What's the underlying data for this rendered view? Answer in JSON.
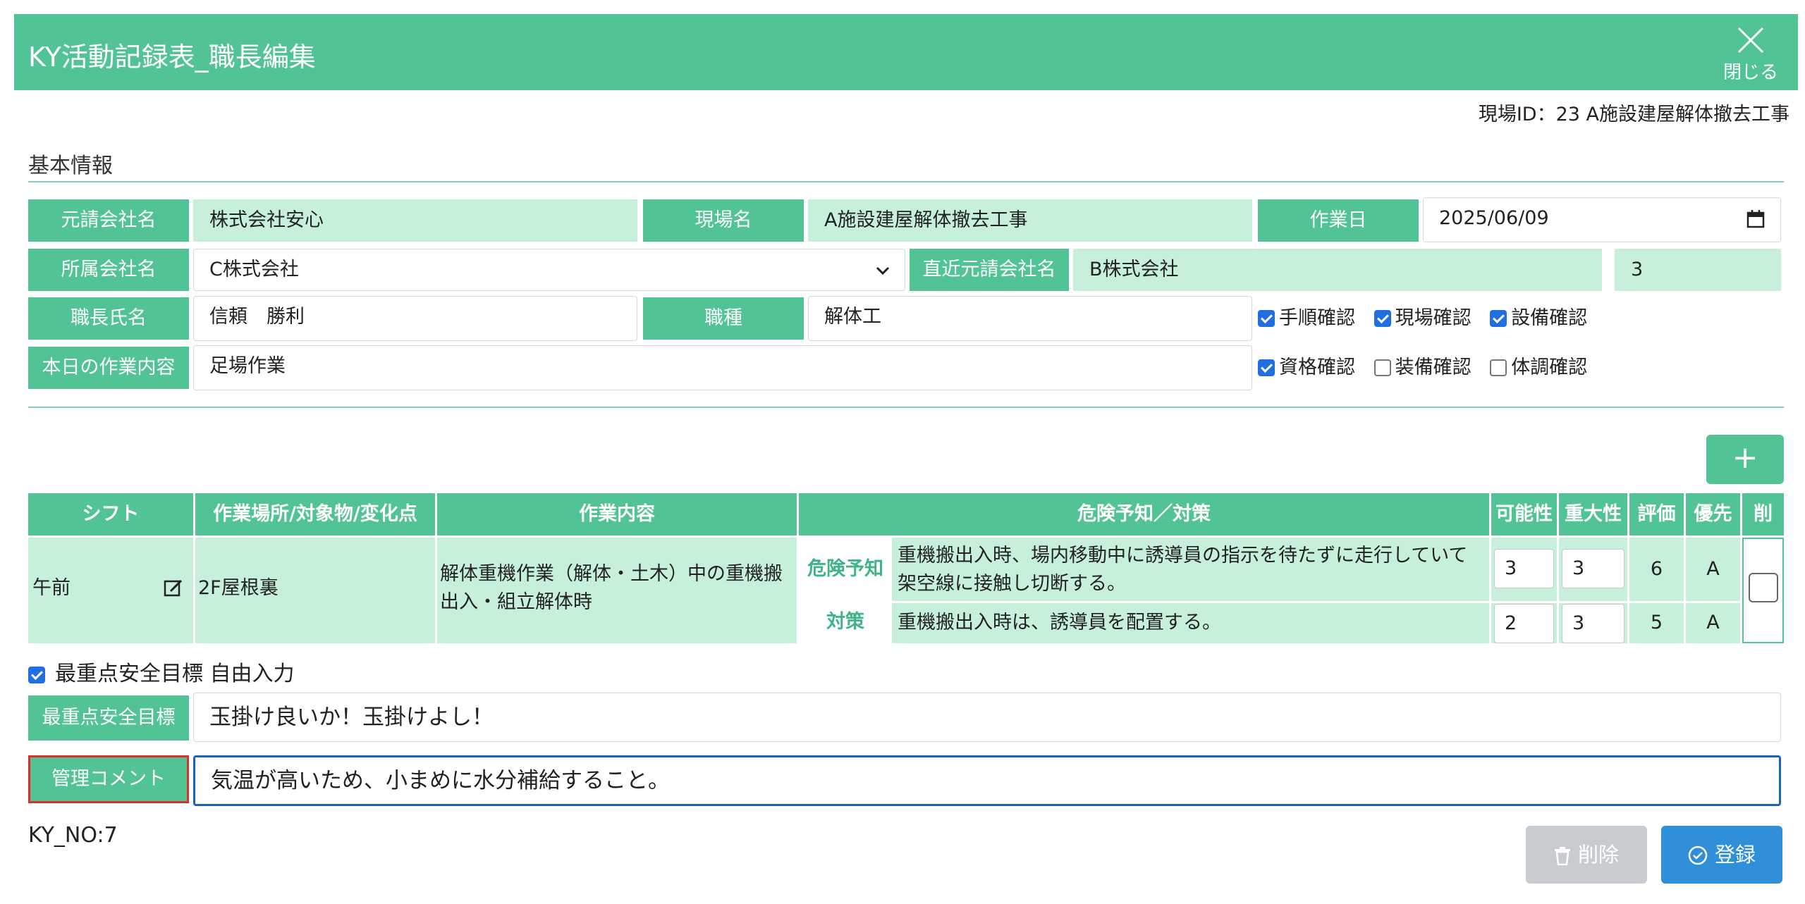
{
  "header": {
    "title": "KY活動記録表_職長編集",
    "close_label": "閉じる"
  },
  "site_id_label": "現場ID：23 A施設建屋解体撤去工事",
  "basic_info": {
    "section_title": "基本情報",
    "prime_company_label": "元請会社名",
    "prime_company_value": "株式会社安心",
    "site_name_label": "現場名",
    "site_name_value": "A施設建屋解体撤去工事",
    "work_date_label": "作業日",
    "work_date_value": "2025/06/09",
    "affiliated_company_label": "所属会社名",
    "affiliated_company_value": "C株式会社",
    "direct_prime_label": "直近元請会社名",
    "direct_prime_value": "B株式会社",
    "direct_prime_extra": "3",
    "foreman_label": "職長氏名",
    "foreman_value": "信頼　勝利",
    "job_type_label": "職種",
    "job_type_value": "解体工",
    "todays_work_label": "本日の作業内容",
    "todays_work_value": "足場作業",
    "checks": [
      {
        "label": "手順確認",
        "checked": true
      },
      {
        "label": "現場確認",
        "checked": true
      },
      {
        "label": "設備確認",
        "checked": true
      },
      {
        "label": "資格確認",
        "checked": true
      },
      {
        "label": "装備確認",
        "checked": false
      },
      {
        "label": "体調確認",
        "checked": false
      }
    ]
  },
  "add_button_label": "+",
  "table": {
    "headers": {
      "shift": "シフト",
      "place": "作業場所/対象物/変化点",
      "work": "作業内容",
      "hazard": "危険予知／対策",
      "possibility": "可能性",
      "severity": "重大性",
      "evaluation": "評価",
      "priority": "優先",
      "delete": "削"
    },
    "row": {
      "shift": "午前",
      "place": "2F屋根裏",
      "work": "解体重機作業（解体・土木）中の重機搬出入・組立解体時",
      "hazard_tag": "危険予知",
      "hazard_text": "重機搬出入時、場内移動中に誘導員の指示を待たずに走行していて架空線に接触し切断する。",
      "hazard_possibility": "3",
      "hazard_severity": "3",
      "hazard_evaluation": "6",
      "hazard_priority": "A",
      "measure_tag": "対策",
      "measure_text": "重機搬出入時は、誘導員を配置する。",
      "measure_possibility": "2",
      "measure_severity": "3",
      "measure_evaluation": "5",
      "measure_priority": "A"
    }
  },
  "free_input_label": "最重点安全目標 自由入力",
  "goal_label": "最重点安全目標",
  "goal_value": "玉掛け良いか！玉掛けよし！",
  "comment_label": "管理コメント",
  "comment_value": "気温が高いため、小まめに水分補給すること。",
  "ky_no": "KY_NO:7",
  "delete_label": "削除",
  "register_label": "登録"
}
